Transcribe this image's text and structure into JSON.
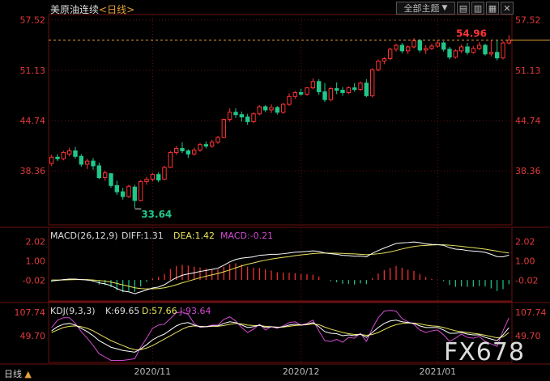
{
  "header": {
    "instrument": "美原油连续",
    "period": "<日线>"
  },
  "toolbar": {
    "topic_label": "全部主题",
    "dropdown_icon": "chevron-down-icon",
    "buttons": [
      "zoom-in-icon",
      "zoom-out-icon",
      "settings-icon",
      "close-icon"
    ]
  },
  "status": {
    "label": "日线",
    "arrow": "▲"
  },
  "watermark": "FX678",
  "colors": {
    "up": "#ff3333",
    "down": "#21c78a",
    "last_price_line": "#e5a23a",
    "diff_line": "#ffffff",
    "dea_line": "#e8e35a",
    "k_line": "#ffffff",
    "d_line": "#e8e35a",
    "j_line": "#d24ad2",
    "axis_text": "#e23a3a",
    "grid": "#6b1010"
  },
  "chart_data": [
    {
      "type": "candlestick",
      "name": "price",
      "ylim": [
        31.5,
        58.0
      ],
      "y_ticks": [
        "57.52",
        "51.13",
        "44.74",
        "38.36"
      ],
      "x_ticks": [
        "2020/11",
        "2020/12",
        "2021/01"
      ],
      "last_price": "54.96",
      "min_label": "33.64",
      "candles": [
        [
          39.3,
          40.4,
          39.0,
          40.1
        ],
        [
          40.1,
          40.5,
          39.6,
          39.9
        ],
        [
          39.9,
          40.9,
          39.7,
          40.7
        ],
        [
          40.5,
          41.3,
          40.2,
          40.9
        ],
        [
          40.9,
          41.4,
          39.9,
          40.2
        ],
        [
          40.2,
          40.5,
          38.9,
          39.2
        ],
        [
          39.2,
          39.9,
          38.6,
          39.6
        ],
        [
          39.6,
          40.0,
          38.5,
          39.0
        ],
        [
          39.0,
          39.4,
          37.3,
          37.5
        ],
        [
          37.5,
          38.4,
          37.1,
          38.1
        ],
        [
          38.0,
          38.1,
          36.2,
          36.5
        ],
        [
          36.5,
          37.1,
          35.3,
          35.7
        ],
        [
          35.7,
          36.2,
          34.7,
          35.1
        ],
        [
          35.1,
          36.6,
          34.9,
          36.4
        ],
        [
          36.3,
          36.6,
          33.64,
          34.6
        ],
        [
          34.6,
          37.2,
          34.5,
          37.0
        ],
        [
          37.0,
          37.6,
          36.6,
          37.3
        ],
        [
          37.3,
          38.1,
          37.0,
          37.9
        ],
        [
          37.9,
          38.2,
          36.9,
          37.2
        ],
        [
          37.3,
          39.0,
          37.2,
          38.8
        ],
        [
          38.8,
          40.9,
          38.7,
          40.7
        ],
        [
          40.7,
          41.5,
          40.4,
          41.2
        ],
        [
          41.2,
          42.0,
          40.6,
          40.9
        ],
        [
          40.9,
          41.1,
          40.0,
          40.5
        ],
        [
          40.5,
          41.3,
          40.3,
          41.0
        ],
        [
          41.0,
          41.9,
          40.8,
          41.7
        ],
        [
          41.7,
          42.1,
          41.2,
          41.5
        ],
        [
          41.5,
          42.3,
          41.3,
          42.0
        ],
        [
          42.0,
          42.8,
          41.8,
          42.6
        ],
        [
          42.6,
          45.0,
          42.5,
          44.9
        ],
        [
          44.9,
          46.3,
          44.6,
          45.8
        ],
        [
          45.8,
          46.3,
          45.1,
          45.5
        ],
        [
          45.5,
          45.9,
          44.6,
          45.2
        ],
        [
          45.2,
          45.6,
          44.2,
          44.6
        ],
        [
          44.6,
          45.8,
          44.4,
          45.6
        ],
        [
          45.6,
          46.7,
          45.4,
          46.5
        ],
        [
          46.5,
          46.7,
          45.8,
          46.1
        ],
        [
          46.1,
          46.8,
          45.7,
          46.4
        ],
        [
          46.4,
          46.6,
          45.5,
          45.8
        ],
        [
          45.8,
          47.0,
          45.6,
          46.8
        ],
        [
          46.8,
          48.2,
          46.6,
          47.8
        ],
        [
          47.8,
          48.5,
          47.5,
          48.3
        ],
        [
          48.3,
          48.8,
          47.9,
          48.1
        ],
        [
          48.1,
          49.0,
          47.9,
          48.9
        ],
        [
          48.9,
          50.1,
          48.7,
          49.7
        ],
        [
          49.7,
          50.0,
          48.0,
          48.4
        ],
        [
          48.4,
          49.5,
          47.1,
          47.4
        ],
        [
          47.4,
          49.0,
          47.2,
          48.8
        ],
        [
          48.8,
          49.6,
          48.1,
          48.6
        ],
        [
          48.6,
          49.0,
          47.9,
          48.3
        ],
        [
          48.3,
          49.1,
          48.1,
          48.9
        ],
        [
          48.9,
          49.5,
          48.4,
          48.7
        ],
        [
          48.7,
          49.7,
          48.5,
          49.5
        ],
        [
          49.5,
          50.0,
          47.7,
          47.9
        ],
        [
          47.9,
          51.4,
          47.7,
          51.2
        ],
        [
          51.2,
          52.5,
          51.0,
          52.3
        ],
        [
          52.3,
          52.8,
          51.9,
          52.6
        ],
        [
          52.6,
          54.0,
          52.4,
          53.8
        ],
        [
          53.8,
          54.5,
          53.5,
          54.3
        ],
        [
          54.3,
          54.6,
          53.3,
          53.6
        ],
        [
          53.6,
          54.3,
          53.2,
          54.1
        ],
        [
          54.1,
          55.2,
          53.9,
          54.9
        ],
        [
          54.9,
          55.1,
          53.4,
          53.7
        ],
        [
          53.7,
          54.3,
          53.2,
          53.9
        ],
        [
          53.9,
          54.5,
          53.7,
          54.2
        ],
        [
          54.2,
          55.0,
          54.0,
          54.6
        ],
        [
          54.6,
          54.8,
          53.5,
          53.8
        ],
        [
          53.8,
          54.1,
          52.5,
          52.8
        ],
        [
          52.8,
          53.8,
          52.6,
          53.6
        ],
        [
          53.6,
          54.4,
          53.3,
          54.1
        ],
        [
          54.1,
          54.6,
          53.1,
          53.4
        ],
        [
          53.4,
          54.2,
          53.2,
          53.9
        ],
        [
          53.9,
          54.7,
          53.7,
          54.3
        ],
        [
          54.3,
          54.5,
          53.0,
          53.2
        ],
        [
          53.2,
          54.9,
          52.9,
          53.4
        ],
        [
          53.4,
          54.9,
          52.4,
          52.7
        ],
        [
          52.7,
          54.8,
          52.5,
          54.6
        ],
        [
          54.6,
          55.6,
          54.4,
          54.96
        ]
      ]
    },
    {
      "type": "line",
      "name": "MACD",
      "label": "MACD(26,12,9)",
      "legend": {
        "diff": "DIFF:1.31",
        "dea": "DEA:1.42",
        "macd": "MACD:-0.21"
      },
      "ylim": [
        -1.1,
        2.6
      ],
      "y_ticks": [
        "2.02",
        "1.00",
        "-0.02"
      ],
      "diff": [
        -0.05,
        -0.02,
        0.02,
        0.05,
        0.05,
        0.02,
        0.0,
        -0.05,
        -0.15,
        -0.2,
        -0.3,
        -0.45,
        -0.58,
        -0.62,
        -0.72,
        -0.62,
        -0.52,
        -0.42,
        -0.37,
        -0.25,
        -0.05,
        0.12,
        0.25,
        0.32,
        0.38,
        0.45,
        0.5,
        0.56,
        0.62,
        0.78,
        0.95,
        1.08,
        1.15,
        1.18,
        1.22,
        1.3,
        1.32,
        1.35,
        1.35,
        1.38,
        1.42,
        1.46,
        1.48,
        1.5,
        1.53,
        1.5,
        1.42,
        1.38,
        1.35,
        1.3,
        1.28,
        1.25,
        1.26,
        1.22,
        1.4,
        1.55,
        1.68,
        1.8,
        1.92,
        1.95,
        1.97,
        2.0,
        1.96,
        1.9,
        1.87,
        1.86,
        1.82,
        1.7,
        1.62,
        1.6,
        1.55,
        1.52,
        1.5,
        1.45,
        1.35,
        1.23,
        1.22,
        1.31
      ],
      "dea": [
        0.0,
        0.0,
        0.0,
        0.01,
        0.02,
        0.02,
        0.02,
        0.0,
        -0.03,
        -0.06,
        -0.11,
        -0.18,
        -0.26,
        -0.33,
        -0.41,
        -0.45,
        -0.47,
        -0.46,
        -0.45,
        -0.41,
        -0.34,
        -0.25,
        -0.15,
        -0.06,
        0.03,
        0.12,
        0.2,
        0.27,
        0.34,
        0.43,
        0.53,
        0.64,
        0.74,
        0.83,
        0.9,
        0.98,
        1.04,
        1.1,
        1.15,
        1.19,
        1.23,
        1.28,
        1.32,
        1.35,
        1.39,
        1.41,
        1.42,
        1.41,
        1.41,
        1.4,
        1.38,
        1.37,
        1.35,
        1.33,
        1.35,
        1.38,
        1.42,
        1.48,
        1.55,
        1.63,
        1.7,
        1.76,
        1.8,
        1.82,
        1.84,
        1.85,
        1.85,
        1.83,
        1.8,
        1.77,
        1.73,
        1.7,
        1.66,
        1.62,
        1.57,
        1.52,
        1.46,
        1.42
      ]
    },
    {
      "type": "line",
      "name": "KDJ",
      "label": "KDJ(9,3,3)",
      "legend": {
        "k": "K:69.65",
        "d": "D:57.66",
        "j": "J:93.64"
      },
      "ylim": [
        -15,
        125
      ],
      "y_ticks": [
        "107.74",
        "49.70"
      ],
      "k": [
        62,
        72,
        78,
        80,
        76,
        68,
        60,
        50,
        38,
        30,
        22,
        18,
        14,
        12,
        10,
        18,
        28,
        40,
        48,
        54,
        64,
        74,
        80,
        82,
        76,
        72,
        72,
        74,
        74,
        80,
        84,
        82,
        76,
        70,
        72,
        76,
        70,
        72,
        70,
        72,
        76,
        78,
        76,
        78,
        82,
        72,
        60,
        56,
        55,
        50,
        52,
        50,
        54,
        46,
        58,
        70,
        80,
        86,
        88,
        84,
        82,
        80,
        74,
        70,
        70,
        70,
        64,
        56,
        56,
        58,
        54,
        52,
        52,
        46,
        42,
        38,
        52,
        69.65
      ],
      "d": [
        58,
        64,
        70,
        73,
        74,
        72,
        68,
        62,
        54,
        46,
        38,
        32,
        26,
        20,
        16,
        16,
        20,
        26,
        34,
        42,
        50,
        58,
        66,
        72,
        74,
        73,
        72,
        73,
        73,
        75,
        78,
        80,
        79,
        76,
        75,
        75,
        73,
        72,
        71,
        71,
        73,
        75,
        76,
        77,
        79,
        77,
        71,
        66,
        62,
        58,
        55,
        53,
        53,
        51,
        53,
        58,
        65,
        72,
        77,
        80,
        81,
        81,
        79,
        76,
        74,
        73,
        70,
        66,
        62,
        60,
        58,
        56,
        54,
        51,
        48,
        45,
        47,
        57.66
      ],
      "j": [
        70,
        88,
        94,
        94,
        80,
        60,
        44,
        26,
        6,
        -2,
        -10,
        -10,
        -10,
        -8,
        -6,
        22,
        44,
        68,
        76,
        78,
        92,
        106,
        108,
        102,
        80,
        70,
        72,
        76,
        76,
        90,
        96,
        86,
        70,
        58,
        66,
        78,
        64,
        72,
        68,
        74,
        82,
        84,
        76,
        80,
        88,
        62,
        38,
        36,
        41,
        34,
        46,
        44,
        56,
        36,
        68,
        94,
        110,
        112,
        110,
        92,
        84,
        78,
        64,
        58,
        62,
        64,
        52,
        36,
        44,
        54,
        46,
        44,
        48,
        36,
        30,
        24,
        62,
        93.64
      ]
    }
  ]
}
